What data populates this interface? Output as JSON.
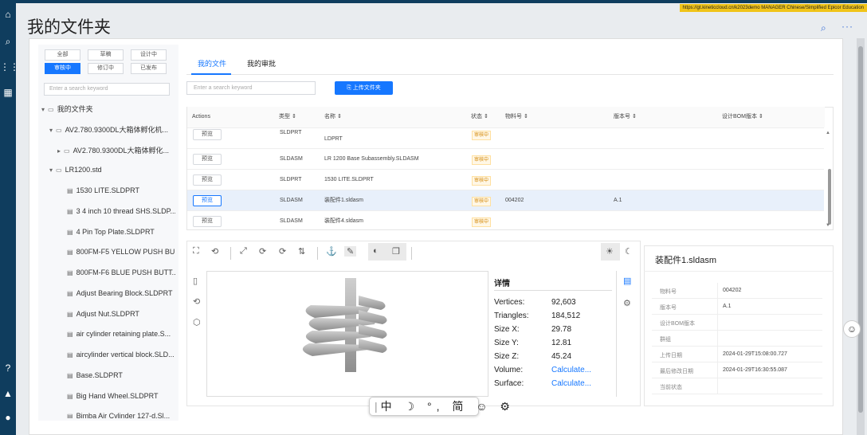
{
  "url_bar": "https://gt.kineticcloud.cn/k2023demo  MANAGER  Chinese/Simplified  Epicor Education",
  "page": {
    "title": "我的文件夹"
  },
  "left": {
    "filters_row1": [
      "全部",
      "草稿",
      "设计中"
    ],
    "filters_row2": [
      "审核中",
      "修订中",
      "已发布"
    ],
    "search_placeholder": "Enter a search keyword",
    "tree": [
      "我的文件夹",
      "AV2.780.9300DL大箱体孵化机...",
      "AV2.780.9300DL大箱体孵化...",
      "LR1200.std",
      "1530 LITE.SLDPRT",
      "3 4 inch 10 thread SHS.SLDP...",
      "4 Pin Top Plate.SLDPRT",
      "800FM-F5 YELLOW PUSH BU...",
      "800FM-F6 BLUE PUSH BUTT...",
      "Adjust Bearing Block.SLDPRT",
      "Adjust Nut.SLDPRT",
      "air cylinder retaining plate.S...",
      "aircylinder vertical block.SLD...",
      "Base.SLDPRT",
      "Big Hand Wheel.SLDPRT",
      "Bimba Air Cylinder 127-d.Sl..."
    ]
  },
  "tabs": [
    "我的文件",
    "我的审批"
  ],
  "search_placeholder": "Enter a search keyword",
  "upload_label": "上传文件夹",
  "table": {
    "headers": [
      "Actions",
      "类型 ⇕",
      "名称 ⇕",
      "状态 ⇕",
      "物料号 ⇕",
      "版本号 ⇕",
      "设计BOM版本 ⇕"
    ],
    "rows": [
      {
        "action": "预览",
        "type": "SLDPRT",
        "name": "LDPRT",
        "status": "审核中",
        "part": "",
        "rev": ""
      },
      {
        "action": "预览",
        "type": "SLDASM",
        "name": "LR 1200 Base Subassembly.SLDASM",
        "status": "审核中",
        "part": "",
        "rev": ""
      },
      {
        "action": "预览",
        "type": "SLDPRT",
        "name": "1530 LITE.SLDPRT",
        "status": "审核中",
        "part": "",
        "rev": ""
      },
      {
        "action": "预览",
        "type": "SLDASM",
        "name": "装配件1.sldasm",
        "status": "审核中",
        "part": "004202",
        "rev": "A.1"
      },
      {
        "action": "预览",
        "type": "SLDASM",
        "name": "装配件4.sldasm",
        "status": "审核中",
        "part": "",
        "rev": ""
      }
    ]
  },
  "details": {
    "title": "详情",
    "items": [
      {
        "k": "Vertices:",
        "v": "92,603"
      },
      {
        "k": "Triangles:",
        "v": "184,512"
      },
      {
        "k": "Size X:",
        "v": "29.78"
      },
      {
        "k": "Size Y:",
        "v": "12.81"
      },
      {
        "k": "Size Z:",
        "v": "45.24"
      },
      {
        "k": "Volume:",
        "v": "Calculate..."
      },
      {
        "k": "Surface:",
        "v": "Calculate..."
      }
    ]
  },
  "card": {
    "title": "装配件1.sldasm",
    "rows": [
      {
        "k": "物料号",
        "v": "004202"
      },
      {
        "k": "版本号",
        "v": "A.1"
      },
      {
        "k": "设计BOM版本",
        "v": ""
      },
      {
        "k": "群组",
        "v": ""
      },
      {
        "k": "上传日期",
        "v": "2024-01-29T15:08:00.727"
      },
      {
        "k": "最后修改日期",
        "v": "2024-01-29T16:30:55.087"
      },
      {
        "k": "当前状态",
        "v": ""
      }
    ]
  },
  "ime": "中 ☽ °, 简 ☺ ⚙",
  "colors": {
    "rail": "#0f3d5e",
    "accent": "#1677ff",
    "url_bar": "#f0c419"
  }
}
